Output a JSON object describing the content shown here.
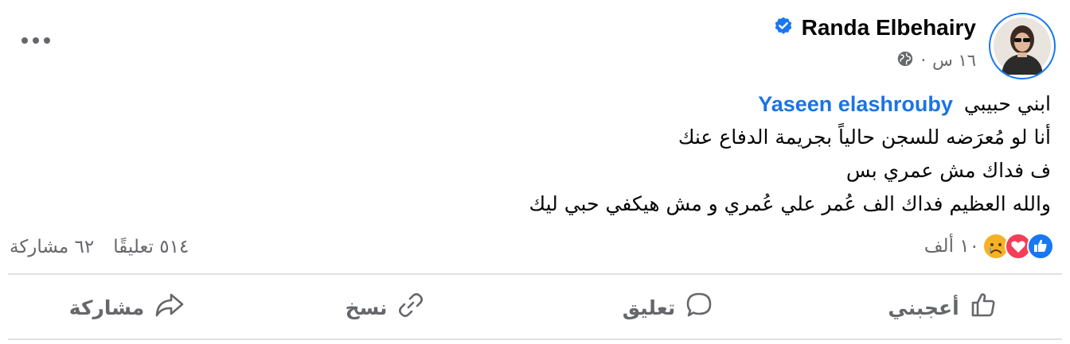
{
  "author": {
    "name": "Randa Elbehairy",
    "verified": true,
    "verified_icon": "verified-badge-icon",
    "avatar_icon": "profile-photo"
  },
  "post": {
    "time": "١٦ س",
    "separator": "·",
    "audience_icon": "globe-icon",
    "tag_name": "Yaseen elashrouby",
    "line1_text": "ابني حبيبي",
    "line2": "أنا لو مُعرَضه للسجن حالياً بجريمة الدفاع عنك",
    "line3": "ف فداك مش عمري بس",
    "line4": "والله العظيم فداك الف عُمر علي عُمري و مش هيكفي حبي ليك"
  },
  "stats": {
    "reactions_count": "١٠ ألف",
    "reaction_types": [
      "like",
      "love",
      "sad"
    ],
    "comments": "٥١٤ تعليقًا",
    "shares": "٦٢ مشاركة"
  },
  "actions": {
    "like": "أعجبني",
    "comment": "تعليق",
    "copy": "نسخ",
    "share": "مشاركة"
  },
  "colors": {
    "accent": "#1877f2",
    "tag": "#1b74e4",
    "secondary_text": "#65676b",
    "love": "#f33e58",
    "sad": "#f7b125"
  }
}
